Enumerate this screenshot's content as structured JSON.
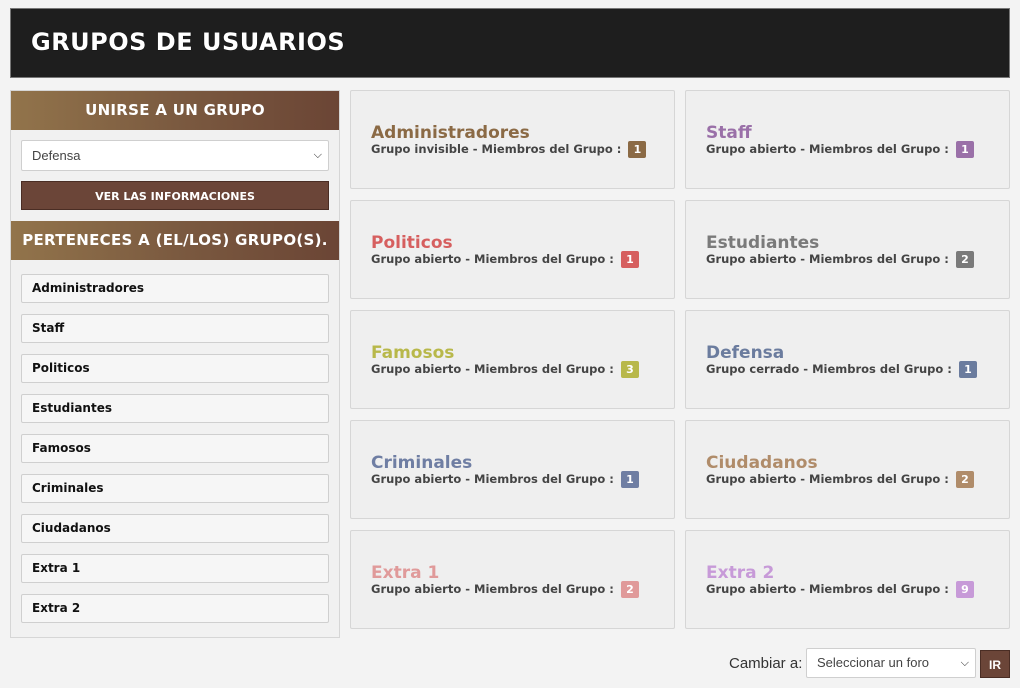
{
  "header": {
    "title": "GRUPOS DE USUARIOS"
  },
  "sidebar": {
    "join_title": "UNIRSE A UN GRUPO",
    "select_value": "Defensa",
    "info_button": "VER LAS INFORMACIONES",
    "member_title": "PERTENECES A (EL/LOS) GRUPO(S).",
    "member_groups": [
      "Administradores",
      "Staff",
      "Politicos",
      "Estudiantes",
      "Famosos",
      "Criminales",
      "Ciudadanos",
      "Extra 1",
      "Extra 2"
    ]
  },
  "groups": [
    {
      "name": "Administradores",
      "status": "Grupo invisible",
      "members_label": "Miembros del Grupo :",
      "count": "1",
      "color": "#8b6a45"
    },
    {
      "name": "Staff",
      "status": "Grupo abierto",
      "members_label": "Miembros del Grupo :",
      "count": "1",
      "color": "#9a70a8"
    },
    {
      "name": "Politicos",
      "status": "Grupo abierto",
      "members_label": "Miembros del Grupo :",
      "count": "1",
      "color": "#d65f5f"
    },
    {
      "name": "Estudiantes",
      "status": "Grupo abierto",
      "members_label": "Miembros del Grupo :",
      "count": "2",
      "color": "#7a7a7a"
    },
    {
      "name": "Famosos",
      "status": "Grupo abierto",
      "members_label": "Miembros del Grupo :",
      "count": "3",
      "color": "#b8b84a"
    },
    {
      "name": "Defensa",
      "status": "Grupo cerrado",
      "members_label": "Miembros del Grupo :",
      "count": "1",
      "color": "#6b7c9e"
    },
    {
      "name": "Criminales",
      "status": "Grupo abierto",
      "members_label": "Miembros del Grupo :",
      "count": "1",
      "color": "#6f7ea3"
    },
    {
      "name": "Ciudadanos",
      "status": "Grupo abierto",
      "members_label": "Miembros del Grupo :",
      "count": "2",
      "color": "#b08c6a"
    },
    {
      "name": "Extra 1",
      "status": "Grupo abierto",
      "members_label": "Miembros del Grupo :",
      "count": "2",
      "color": "#e09a9a"
    },
    {
      "name": "Extra 2",
      "status": "Grupo abierto",
      "members_label": "Miembros del Grupo :",
      "count": "9",
      "color": "#c79ad8"
    }
  ],
  "footer": {
    "jump_label": "Cambiar a:",
    "jump_placeholder": "Seleccionar un foro",
    "go_button": "IR"
  }
}
